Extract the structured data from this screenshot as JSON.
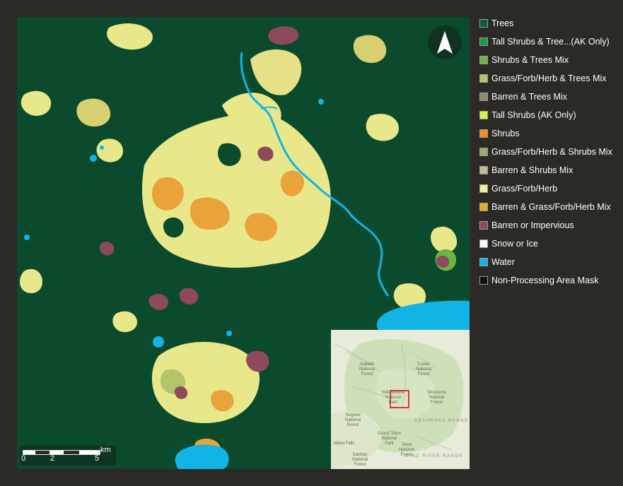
{
  "colors": {
    "background": "#2b2a26",
    "trees": "#0b4a2c",
    "grass": "#e8e88a",
    "shrubs": "#eaa23a",
    "barren": "#8c4a5c",
    "water": "#12b4e6",
    "inset_bg": "#e6ecd9",
    "inset_box": "#e01010"
  },
  "north_arrow": {
    "icon": "north-arrow-icon"
  },
  "scalebar": {
    "labels": [
      "0",
      "2",
      "5"
    ],
    "unit": "km"
  },
  "inset": {
    "labels": [
      "Gallatin\nNational\nForest",
      "Custer\nNational\nForest",
      "Yellowstone\nNational\nPark",
      "Shoshone\nNational\nForest",
      "Targhee\nNational\nForest",
      "Grand Teton\nNational\nPark",
      "Teton\nNational\nForest",
      "Idaho Falls",
      "Caribou\nNational\nForest"
    ],
    "ranges": [
      "ABSAROKA RANGE",
      "WIND RIVER RANGE"
    ]
  },
  "legend": {
    "items": [
      {
        "label": "Trees",
        "color": "#0f5a37"
      },
      {
        "label": "Tall Shrubs & Tree...(AK Only)",
        "color": "#1e9a4c"
      },
      {
        "label": "Shrubs & Trees Mix",
        "color": "#6bb342"
      },
      {
        "label": "Grass/Forb/Herb & Trees Mix",
        "color": "#b4c46a"
      },
      {
        "label": "Barren & Trees Mix",
        "color": "#8f8a66"
      },
      {
        "label": "Tall Shrubs (AK Only)",
        "color": "#d6f24a"
      },
      {
        "label": "Shrubs",
        "color": "#f0941e"
      },
      {
        "label": "Grass/Forb/Herb & Shrubs Mix",
        "color": "#9aa86a"
      },
      {
        "label": "Barren & Shrubs Mix",
        "color": "#c0bc96"
      },
      {
        "label": "Grass/Forb/Herb",
        "color": "#eef0a0"
      },
      {
        "label": "Barren & Grass/Forb/Herb Mix",
        "color": "#dcb028"
      },
      {
        "label": "Barren or Impervious",
        "color": "#8c4a5c"
      },
      {
        "label": "Snow or Ice",
        "color": "#f4fbfd"
      },
      {
        "label": "Water",
        "color": "#12b4e6"
      },
      {
        "label": "Non-Processing Area Mask",
        "color": "#111111"
      }
    ]
  }
}
